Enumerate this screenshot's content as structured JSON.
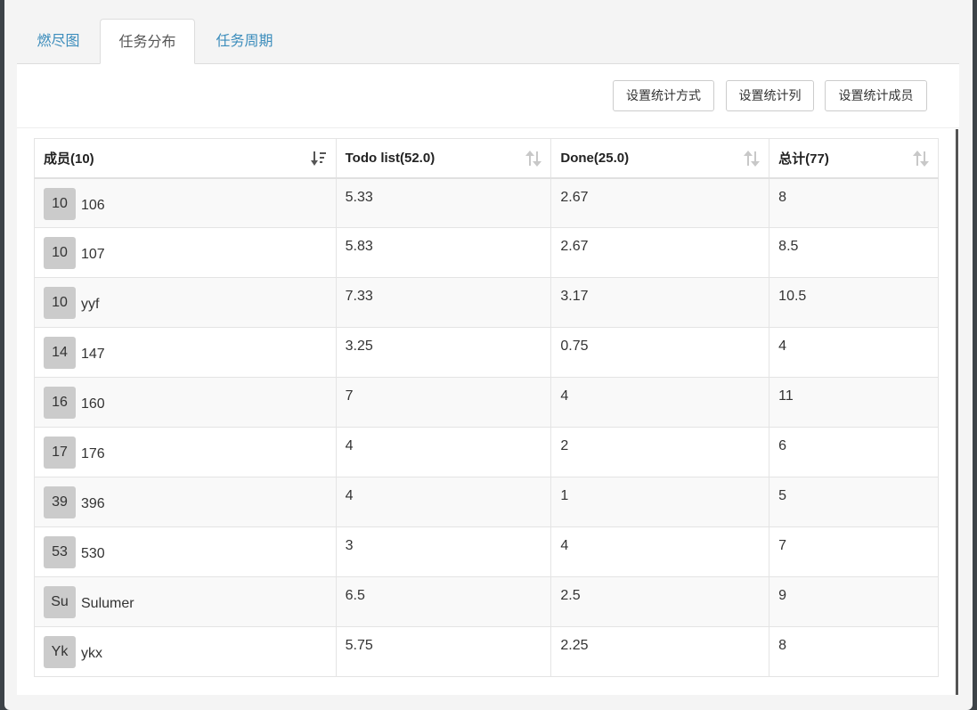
{
  "tabs": [
    {
      "label": "燃尽图"
    },
    {
      "label": "任务分布"
    },
    {
      "label": "任务周期"
    }
  ],
  "toolbar": {
    "btn_stat_method": "设置统计方式",
    "btn_stat_columns": "设置统计列",
    "btn_stat_members": "设置统计成员"
  },
  "table": {
    "headers": [
      "成员(10)",
      "Todo list(52.0)",
      "Done(25.0)",
      "总计(77)"
    ],
    "rows": [
      {
        "avatar": "10",
        "name": "106",
        "todo": "5.33",
        "done": "2.67",
        "total": "8"
      },
      {
        "avatar": "10",
        "name": "107",
        "todo": "5.83",
        "done": "2.67",
        "total": "8.5"
      },
      {
        "avatar": "10",
        "name": "yyf",
        "todo": "7.33",
        "done": "3.17",
        "total": "10.5"
      },
      {
        "avatar": "14",
        "name": "147",
        "todo": "3.25",
        "done": "0.75",
        "total": "4"
      },
      {
        "avatar": "16",
        "name": "160",
        "todo": "7",
        "done": "4",
        "total": "11"
      },
      {
        "avatar": "17",
        "name": "176",
        "todo": "4",
        "done": "2",
        "total": "6"
      },
      {
        "avatar": "39",
        "name": "396",
        "todo": "4",
        "done": "1",
        "total": "5"
      },
      {
        "avatar": "53",
        "name": "530",
        "todo": "3",
        "done": "4",
        "total": "7"
      },
      {
        "avatar": "Su",
        "name": "Sulumer",
        "todo": "6.5",
        "done": "2.5",
        "total": "9"
      },
      {
        "avatar": "Yk",
        "name": "ykx",
        "todo": "5.75",
        "done": "2.25",
        "total": "8"
      }
    ]
  },
  "colors": {
    "tab_link": "#3c8dbc",
    "avatar_bg": "#cbcbcb",
    "row_stripe": "#f9f9f9"
  }
}
